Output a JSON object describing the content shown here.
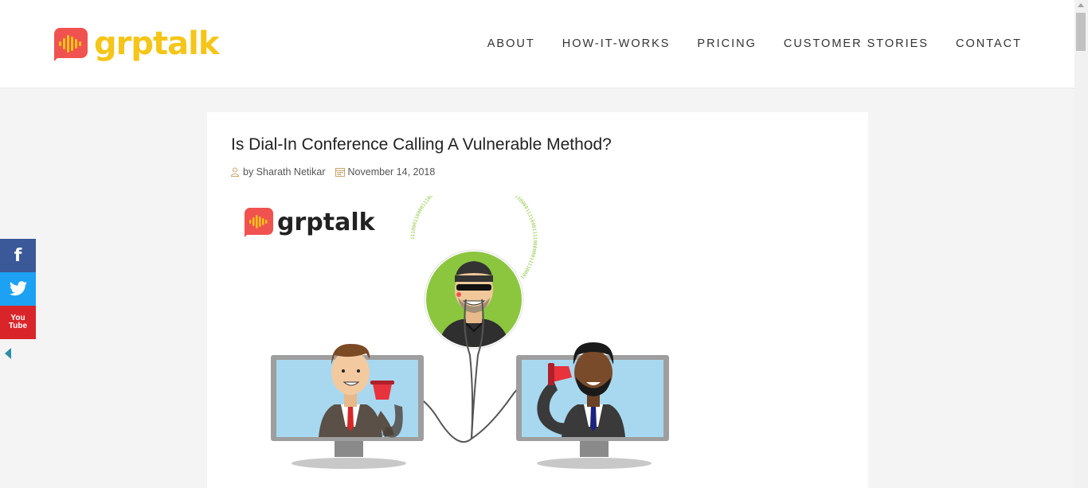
{
  "site": {
    "logo_text": "grptalk",
    "brand_colors": {
      "logo_red": "#f0524f",
      "logo_yellow": "#f5c518"
    }
  },
  "nav": {
    "items": [
      {
        "label": "ABOUT"
      },
      {
        "label": "HOW-IT-WORKS"
      },
      {
        "label": "PRICING"
      },
      {
        "label": "CUSTOMER STORIES"
      },
      {
        "label": "CONTACT"
      }
    ]
  },
  "post": {
    "title": "Is Dial-In Conference Calling A Vulnerable Method?",
    "author": "by Sharath Netikar",
    "date": "November 14, 2018",
    "featured_image": {
      "logo_text": "grptalk",
      "binary_ring_text": "1110001100001110000101111100000111100011110000011100001111000111100000011110001"
    }
  },
  "social": {
    "items": [
      {
        "icon": "facebook-icon",
        "label": "f"
      },
      {
        "icon": "twitter-icon",
        "label": ""
      },
      {
        "icon": "youtube-icon",
        "label_top": "You",
        "label_bottom": "Tube"
      }
    ]
  }
}
